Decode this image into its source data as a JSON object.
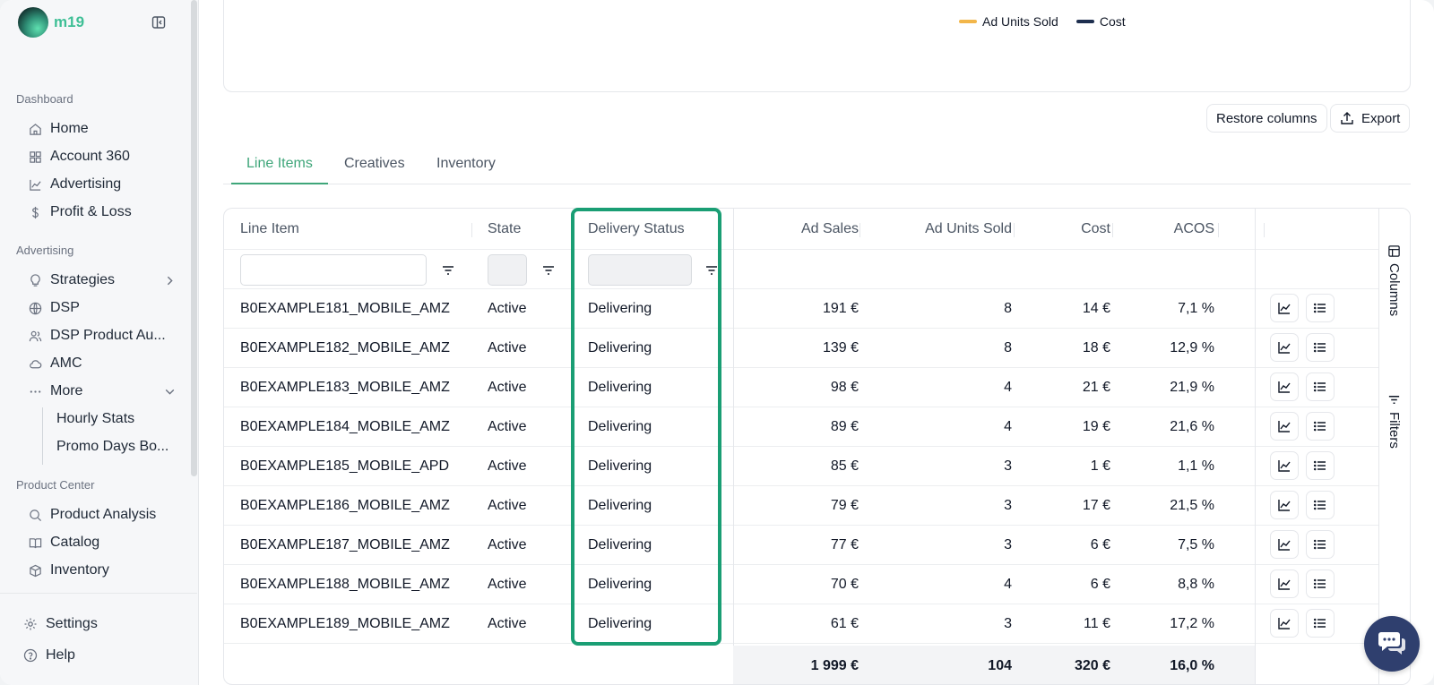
{
  "brand": {
    "name": "m19"
  },
  "sidebar": {
    "sections": [
      {
        "title": "Dashboard",
        "items": [
          "Home",
          "Account 360",
          "Advertising",
          "Profit & Loss"
        ]
      },
      {
        "title": "Advertising",
        "items": [
          "Strategies",
          "DSP",
          "DSP Product Au...",
          "AMC",
          "More"
        ],
        "sub_items": [
          "Hourly Stats",
          "Promo Days Bo..."
        ]
      },
      {
        "title": "Product Center",
        "items": [
          "Product Analysis",
          "Catalog",
          "Inventory"
        ]
      }
    ],
    "footer": [
      "Settings",
      "Help"
    ]
  },
  "chart": {
    "legend": [
      {
        "label": "Ad Units Sold",
        "color": "#f2b64a"
      },
      {
        "label": "Cost",
        "color": "#1e2f4f"
      }
    ]
  },
  "toolbar": {
    "restore_label": "Restore columns",
    "export_label": "Export"
  },
  "tabs": [
    {
      "label": "Line Items",
      "active": true
    },
    {
      "label": "Creatives",
      "active": false
    },
    {
      "label": "Inventory",
      "active": false
    }
  ],
  "table": {
    "columns": [
      "Line Item",
      "State",
      "Delivery Status",
      "Ad Sales",
      "Ad Units Sold",
      "Cost",
      "ACOS"
    ],
    "rows": [
      [
        "B0EXAMPLE181_MOBILE_AMZ",
        "Active",
        "Delivering",
        "191 €",
        "8",
        "14 €",
        "7,1 %"
      ],
      [
        "B0EXAMPLE182_MOBILE_AMZ",
        "Active",
        "Delivering",
        "139 €",
        "8",
        "18 €",
        "12,9 %"
      ],
      [
        "B0EXAMPLE183_MOBILE_AMZ",
        "Active",
        "Delivering",
        "98 €",
        "4",
        "21 €",
        "21,9 %"
      ],
      [
        "B0EXAMPLE184_MOBILE_AMZ",
        "Active",
        "Delivering",
        "89 €",
        "4",
        "19 €",
        "21,6 %"
      ],
      [
        "B0EXAMPLE185_MOBILE_APD",
        "Active",
        "Delivering",
        "85 €",
        "3",
        "1 €",
        "1,1 %"
      ],
      [
        "B0EXAMPLE186_MOBILE_AMZ",
        "Active",
        "Delivering",
        "79 €",
        "3",
        "17 €",
        "21,5 %"
      ],
      [
        "B0EXAMPLE187_MOBILE_AMZ",
        "Active",
        "Delivering",
        "77 €",
        "3",
        "6 €",
        "7,5 %"
      ],
      [
        "B0EXAMPLE188_MOBILE_AMZ",
        "Active",
        "Delivering",
        "70 €",
        "4",
        "6 €",
        "8,8 %"
      ],
      [
        "B0EXAMPLE189_MOBILE_AMZ",
        "Active",
        "Delivering",
        "61 €",
        "3",
        "11 €",
        "17,2 %"
      ]
    ],
    "totals": {
      "ad_sales": "1 999 €",
      "ad_units_sold": "104",
      "cost": "320 €",
      "acos": "16,0 %"
    }
  },
  "side_panel": {
    "columns_label": "Columns",
    "filters_label": "Filters"
  },
  "highlight_color": "#1a9e74"
}
